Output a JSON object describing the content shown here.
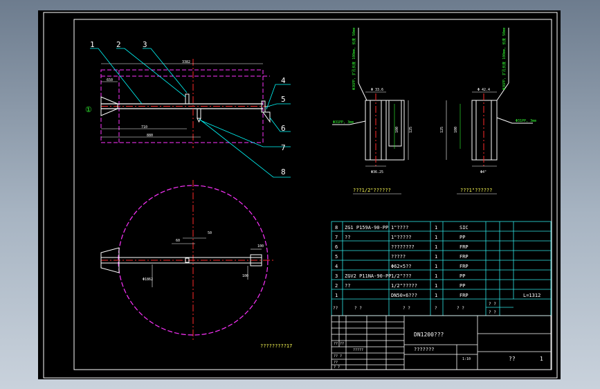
{
  "drawing": {
    "part_numbers": [
      "1",
      "2",
      "3",
      "4",
      "5",
      "6",
      "7",
      "8"
    ],
    "circle_ref": "①",
    "dims_top": {
      "overall": "3382",
      "d1": "650",
      "d2": "710",
      "d3": "880"
    },
    "dims_plan": {
      "a": "50",
      "b": "60",
      "c": "100",
      "d": "100",
      "e": "Φ1862"
    },
    "detail_left": {
      "callout": "Φ31PP, 3mm",
      "lead_text": "Φ36PP, 扩孔长度 100mm, 长度 50mm",
      "width_top": "Φ 33.6",
      "width_bottom": "Φ36.25",
      "h1": "125",
      "h2": "100",
      "caption": "???1/2\"??????"
    },
    "detail_right": {
      "callout": "Φ31PP, 3mm",
      "lead_text": "Φ36PP, 扩孔长度 100mm, 长度 50mm",
      "width_top": "Φ 42.4",
      "width_bottom": "Φ4\"",
      "h1": "125",
      "h2": "100",
      "caption": "???1\"??????"
    },
    "plan_caption": "?????????17"
  },
  "bom": {
    "rows": [
      {
        "no": "8",
        "code": "ZG1 P159A-90-PP",
        "name": "1\"????",
        "qty": "1",
        "material": "SIC"
      },
      {
        "no": "7",
        "code": "??",
        "name": "1\"?????",
        "qty": "1",
        "material": "PP"
      },
      {
        "no": "6",
        "code": "",
        "name": "????????",
        "qty": "1",
        "material": "FRP"
      },
      {
        "no": "5",
        "code": "",
        "name": "?????",
        "qty": "1",
        "material": "FRP"
      },
      {
        "no": "4",
        "code": "",
        "name": "Φ62×5??",
        "qty": "1",
        "material": "FRP"
      },
      {
        "no": "3",
        "code": "ZGV2 P11NA-90-PP",
        "name": "1/2\"???",
        "qty": "1",
        "material": "PP"
      },
      {
        "no": "2",
        "code": "??",
        "name": "1/2\"?????",
        "qty": "1",
        "material": "PP"
      },
      {
        "no": "1",
        "code": "",
        "name": "DN50×6???",
        "qty": "1",
        "material": "FRP"
      }
    ],
    "note": "L=1312",
    "header": {
      "c1": "??",
      "c2": "?   ?",
      "c3": "?   ?",
      "c4": "?",
      "c5": "?   ?",
      "c6": "? ?",
      "c7": "? ?"
    }
  },
  "title_block": {
    "title_line1": "DN1200???",
    "title_line2": "???????",
    "scale": "1:10",
    "sheet_label": "??",
    "sheet_no": "1",
    "sign_rows": [
      "?? ??",
      "?????",
      "?? ?",
      "??",
      "? ?",
      "? ?"
    ]
  },
  "colors": {
    "background": "#000000",
    "line": "#ffffff",
    "center": "#ff2a2a",
    "hidden": "#ff33ff",
    "leader": "#00ffff",
    "text_green": "#33ff33",
    "text_yellow": "#ffff55",
    "table": "#2fe6e6"
  }
}
